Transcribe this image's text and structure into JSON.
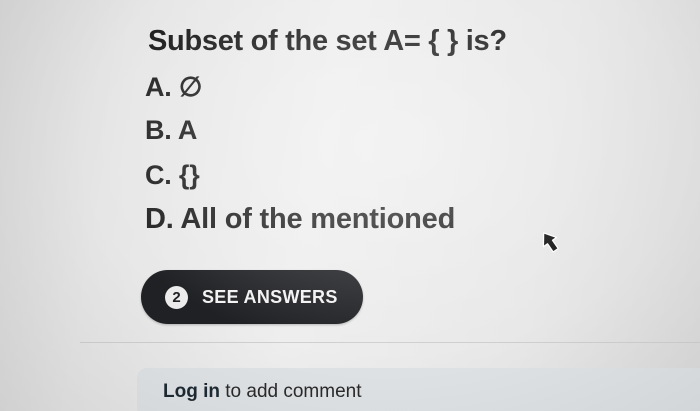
{
  "question": {
    "text": "Subset of the set A= { } is?",
    "options": [
      "A. ∅",
      "B. A",
      "C. {}",
      "D. All of the mentioned"
    ]
  },
  "answers_button": {
    "count": "2",
    "label": "SEE ANSWERS"
  },
  "comment": {
    "login_label": "Log in",
    "rest_label": " to add comment"
  },
  "colors": {
    "button_bg": "#202124",
    "text": "#1c1c1c",
    "comment_bar": "#dfe3e6"
  }
}
